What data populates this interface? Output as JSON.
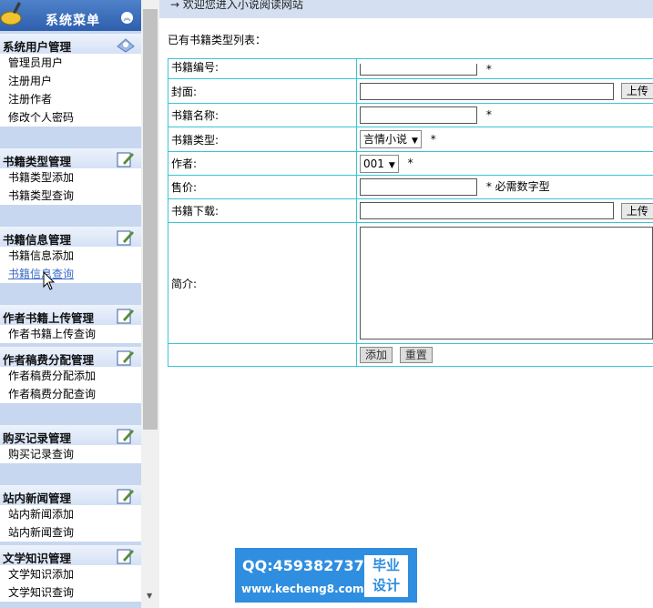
{
  "menu": {
    "title": "系统菜单",
    "groups": [
      {
        "title": "系统用户管理",
        "items": [
          "管理员用户",
          "注册用户",
          "注册作者",
          "修改个人密码"
        ]
      },
      {
        "title": "书籍类型管理",
        "items": [
          "书籍类型添加",
          "书籍类型查询"
        ]
      },
      {
        "title": "书籍信息管理",
        "items": [
          "书籍信息添加",
          "书籍信息查询"
        ]
      },
      {
        "title": "作者书籍上传管理",
        "items": [
          "作者书籍上传查询"
        ]
      },
      {
        "title": "作者稿费分配管理",
        "items": [
          "作者稿费分配添加",
          "作者稿费分配查询"
        ]
      },
      {
        "title": "购买记录管理",
        "items": [
          "购买记录查询"
        ]
      },
      {
        "title": "站内新闻管理",
        "items": [
          "站内新闻添加",
          "站内新闻查询"
        ]
      },
      {
        "title": "文学知识管理",
        "items": [
          "文学知识添加",
          "文学知识查询"
        ]
      }
    ]
  },
  "content": {
    "welcome": "→ 欢迎您进入小说阅读网站",
    "list_title": "已有书籍类型列表：",
    "form": {
      "book_no_label": "书籍编号:",
      "cover_label": "封面:",
      "name_label": "书籍名称:",
      "type_label": "书籍类型:",
      "type_value": "言情小说",
      "author_label": "作者:",
      "author_value": "001",
      "price_label": "售价:",
      "price_hint": "必需数字型",
      "download_label": "书籍下载:",
      "intro_label": "简介:",
      "required_mark": "*",
      "upload_label": "上传",
      "add_label": "添加",
      "reset_label": "重置"
    }
  },
  "watermark": {
    "qq": "QQ:459382737",
    "site": "www.kecheng8.com",
    "badge_line1": "毕业",
    "badge_line2": "设计"
  },
  "colors": {
    "menu_bg": "#c7d7f0",
    "menu_header": "#2e5fae",
    "table_border": "#39c5d6",
    "watermark_bg": "#2f8ee0"
  }
}
